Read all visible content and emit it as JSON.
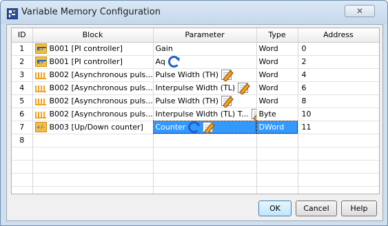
{
  "window": {
    "title": "Variable Memory Configuration",
    "close_glyph": "✕"
  },
  "table": {
    "headers": {
      "id": "ID",
      "block": "Block",
      "parameter": "Parameter",
      "type": "Type",
      "address": "Address"
    },
    "rows": [
      {
        "id": "1",
        "block_icon": "pi-controller-icon",
        "block": "B001 [PI controller]",
        "parameter": "Gain",
        "param_icons": [],
        "type": "Word",
        "address": "0"
      },
      {
        "id": "2",
        "block_icon": "pi-controller-icon",
        "block": "B001 [PI controller]",
        "parameter": "Aq",
        "param_icons": [
          "refresh-icon"
        ],
        "type": "Word",
        "address": "2"
      },
      {
        "id": "3",
        "block_icon": "pulse-icon",
        "block": "B002 [Asynchronous puls...",
        "parameter": "Pulse Width (TH)",
        "param_icons": [
          "edit-icon"
        ],
        "type": "Word",
        "address": "4"
      },
      {
        "id": "4",
        "block_icon": "pulse-icon",
        "block": "B002 [Asynchronous puls...",
        "parameter": "Interpulse Width (TL)",
        "param_icons": [
          "edit-icon"
        ],
        "type": "Word",
        "address": "6"
      },
      {
        "id": "5",
        "block_icon": "pulse-icon",
        "block": "B002 [Asynchronous puls...",
        "parameter": "Pulse Width (TH)",
        "param_icons": [
          "edit-icon"
        ],
        "type": "Word",
        "address": "8"
      },
      {
        "id": "6",
        "block_icon": "pulse-icon",
        "block": "B002 [Asynchronous puls...",
        "parameter": "Interpulse Width (TL) T...",
        "param_icons": [
          "edit-icon"
        ],
        "type": "Byte",
        "address": "10"
      },
      {
        "id": "7",
        "block_icon": "up-down-counter-icon",
        "block": "B003 [Up/Down counter]",
        "parameter": "Counter",
        "param_icons": [
          "refresh-icon",
          "edit-icon"
        ],
        "type": "DWord",
        "address": "11"
      },
      {
        "id": "8",
        "block_icon": "",
        "block": "",
        "parameter": "",
        "param_icons": [],
        "type": "",
        "address": ""
      }
    ],
    "empty_rows": 5,
    "selected_row": 7
  },
  "buttons": {
    "ok": "OK",
    "cancel": "Cancel",
    "help": "Help"
  },
  "colors": {
    "selection": "#3399ff",
    "title_bar": "#cfdfee",
    "block_icon": "#f4bf3e"
  }
}
